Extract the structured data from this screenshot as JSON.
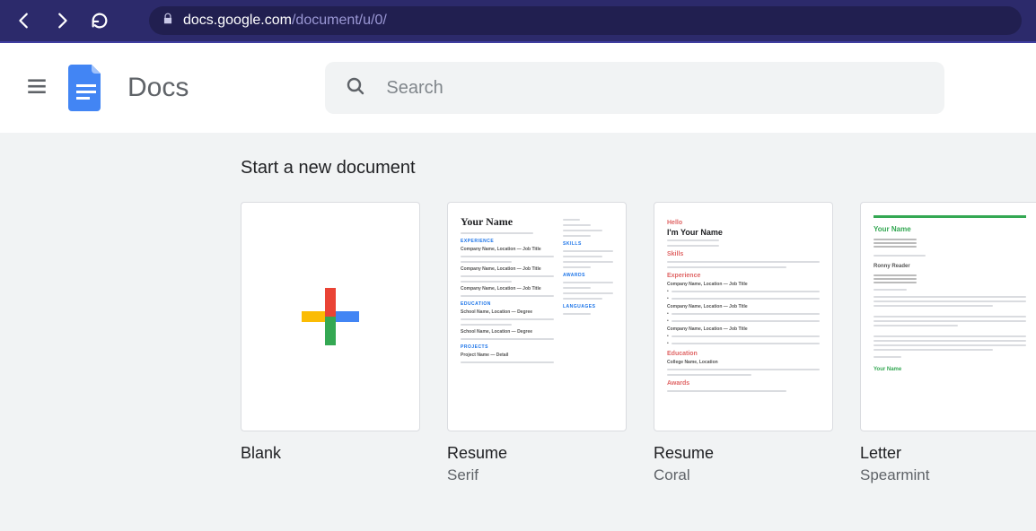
{
  "browser": {
    "url_host": "docs.google.com",
    "url_path": "/document/u/0/"
  },
  "header": {
    "app_name": "Docs",
    "search_placeholder": "Search"
  },
  "templates": {
    "section_title": "Start a new document",
    "items": [
      {
        "title": "Blank",
        "subtitle": ""
      },
      {
        "title": "Resume",
        "subtitle": "Serif"
      },
      {
        "title": "Resume",
        "subtitle": "Coral"
      },
      {
        "title": "Letter",
        "subtitle": "Spearmint"
      }
    ]
  },
  "thumb_labels": {
    "your_name": "Your Name",
    "im_your_name": "I'm Your Name"
  }
}
